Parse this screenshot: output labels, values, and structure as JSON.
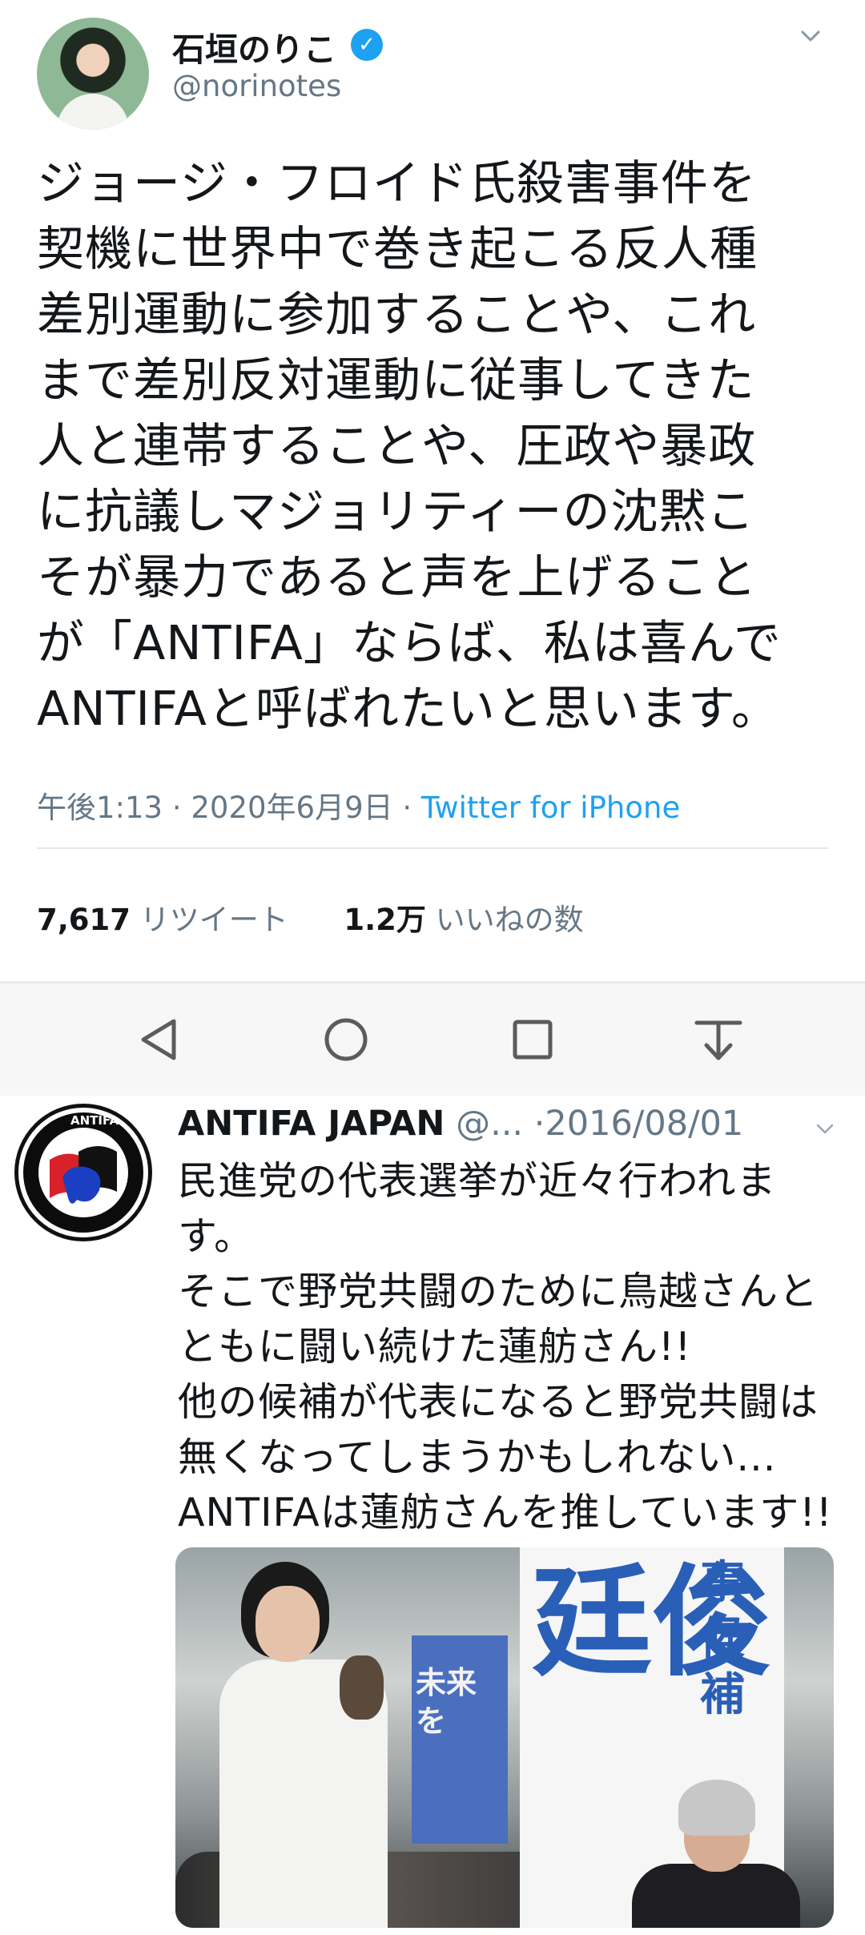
{
  "tweet1": {
    "display_name": "石垣のりこ",
    "handle": "@norinotes",
    "body_lines": [
      "ジョージ・フロイド氏殺害事件を",
      "契機に世界中で巻き起こる反人種",
      "差別運動に参加することや、これ",
      "まで差別反対運動に従事してきた",
      "人と連帯することや、圧政や暴政",
      "に抗議しマジョリティーの沈黙こ",
      "そが暴力であると声を上げること",
      "が「ANTIFA」ならば、私は喜んで",
      "ANTIFAと呼ばれたいと思います。"
    ],
    "timestamp": "午後1:13 · 2020年6月9日 · ",
    "source": "Twitter for iPhone",
    "retweet_count": "7,617",
    "retweet_label": "リツイート",
    "like_count": "1.2万",
    "like_label": "いいねの数",
    "colors": {
      "accent": "#1da1f2",
      "muted": "#657786",
      "text": "#14171a"
    }
  },
  "navbar": {
    "buttons": [
      "back-icon",
      "home-icon",
      "recents-icon",
      "notification-pull-icon"
    ]
  },
  "tweet2": {
    "display_name": "ANTIFA JAPAN",
    "handle": "@...",
    "date": "·2016/08/01",
    "avatar_text": "ANTIFA",
    "body_lines": [
      "民進党の代表選挙が近々行われま",
      "す。",
      "そこで野党共闘のために鳥越さんと",
      "ともに闘い続けた蓮舫さん!!",
      "他の候補が代表になると野党共闘は",
      "無くなってしまうかもしれない...",
      "ANTIFAは蓮舫さんを推しています!!"
    ],
    "photo": {
      "sign_big": "廷俊",
      "sign_side": "事候補",
      "banner_text": "未来を"
    }
  }
}
